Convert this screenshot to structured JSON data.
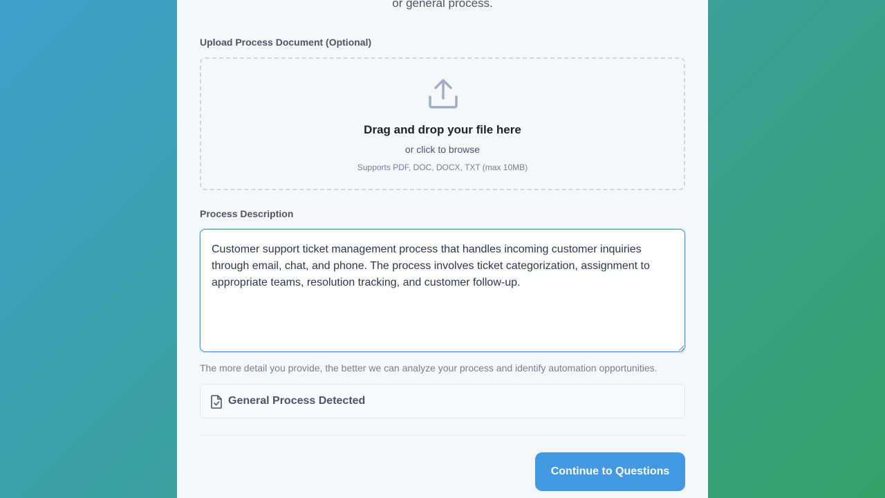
{
  "header": {
    "subtitle_tail": "or general process."
  },
  "upload": {
    "label": "Upload Process Document (Optional)",
    "icon": "upload-icon",
    "title": "Drag and drop your file here",
    "subtitle": "or click to browse",
    "hint": "Supports PDF, DOC, DOCX, TXT (max 10MB)"
  },
  "description": {
    "label": "Process Description",
    "value": "Customer support ticket management process that handles incoming customer inquiries through email, chat, and phone. The process involves ticket categorization, assignment to appropriate teams, resolution tracking, and customer follow-up.",
    "help": "The more detail you provide, the better we can analyze your process and identify automation opportunities."
  },
  "detection": {
    "icon": "file-check-icon",
    "text": "General Process Detected"
  },
  "actions": {
    "continue_label": "Continue to Questions"
  },
  "colors": {
    "accent": "#4299e1",
    "gradient_start": "#3f9fcc",
    "gradient_end": "#38a169",
    "card_bg": "#f5f8fb"
  }
}
